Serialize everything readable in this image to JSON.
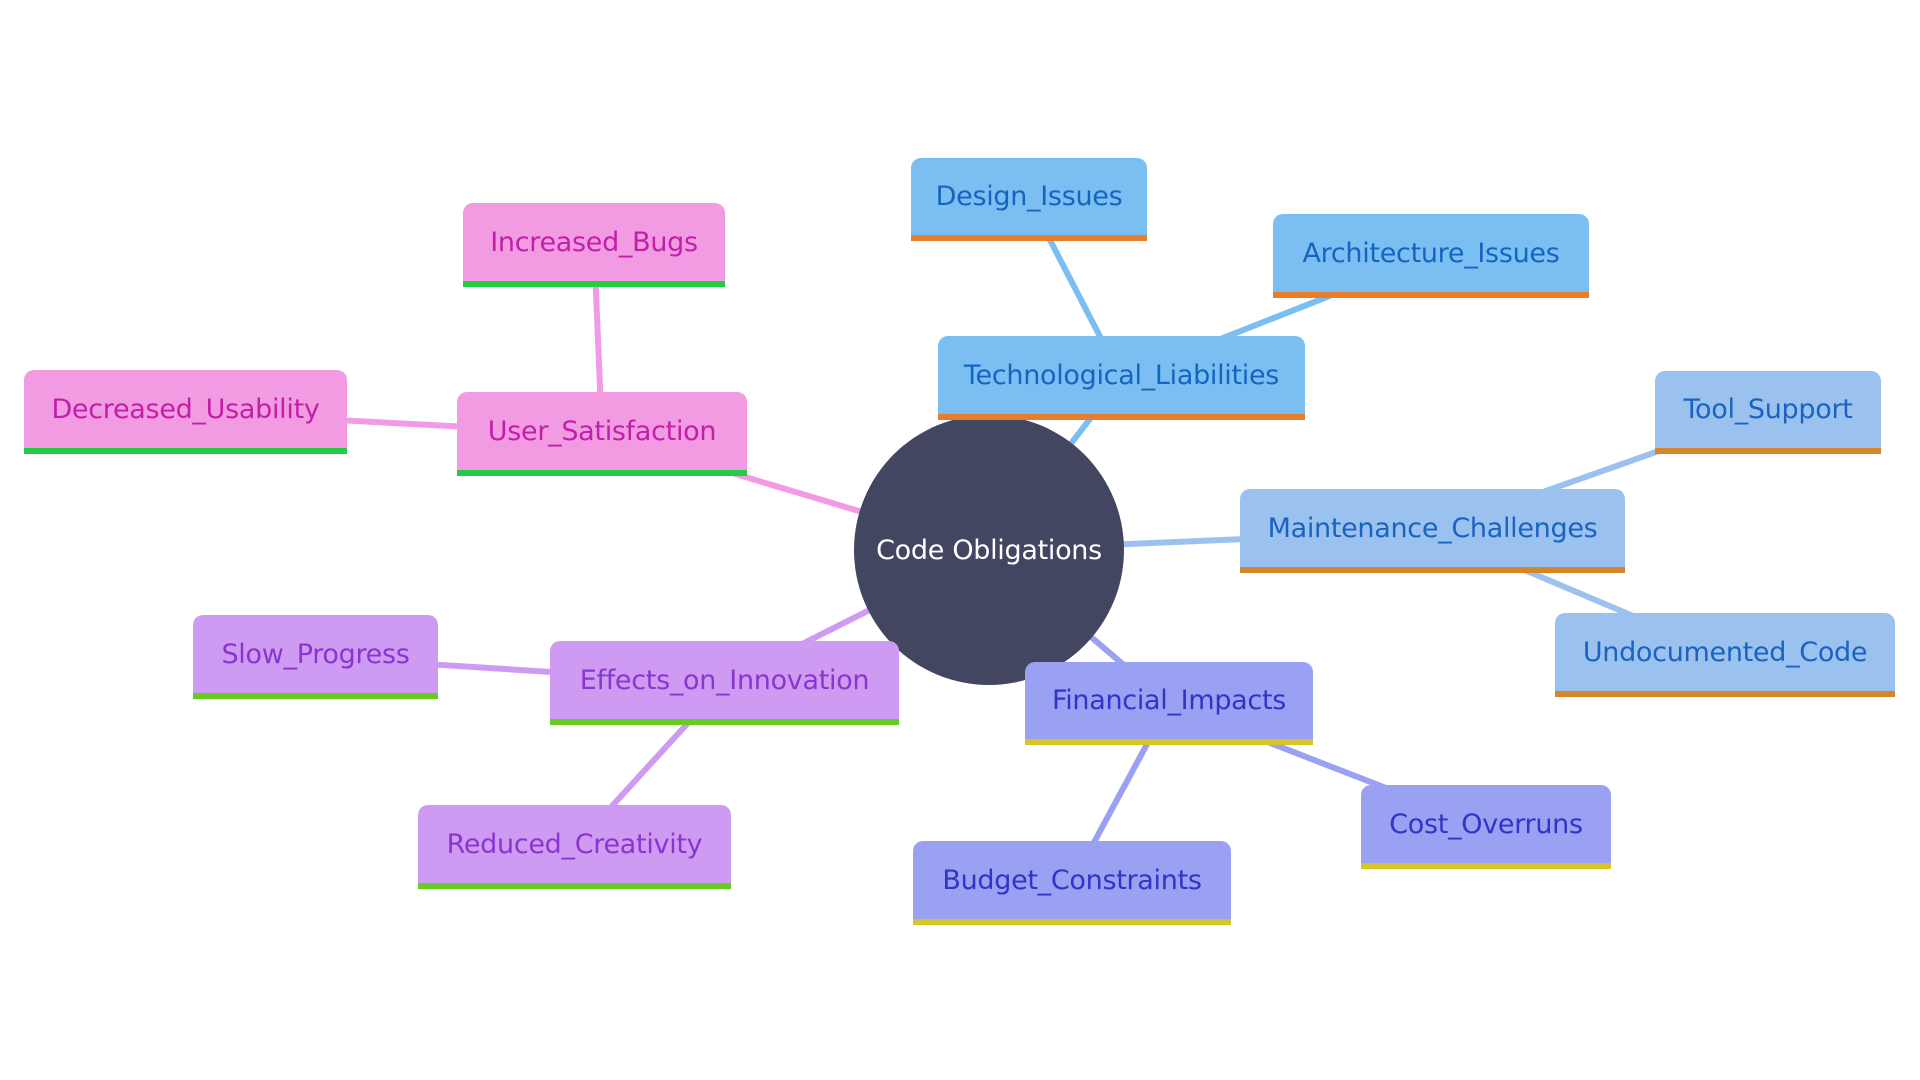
{
  "diagram": {
    "type": "mindmap",
    "root": {
      "label": "Code Obligations",
      "color": "#424660",
      "text_color": "#ffffff"
    },
    "branches": [
      {
        "id": "tech",
        "label": "Technological_Liabilities",
        "fill": "#7bbff2",
        "text_color": "#1565c0",
        "bar_color": "#e87d2c",
        "edge_color": "#7bbff2",
        "children": [
          {
            "id": "design",
            "label": "Design_Issues"
          },
          {
            "id": "arch",
            "label": "Architecture_Issues"
          }
        ]
      },
      {
        "id": "maint",
        "label": "Maintenance_Challenges",
        "fill": "#9bc2ef",
        "text_color": "#1a63c0",
        "bar_color": "#d6852a",
        "edge_color": "#9bc2ef",
        "children": [
          {
            "id": "tool",
            "label": "Tool_Support"
          },
          {
            "id": "undoc",
            "label": "Undocumented_Code"
          }
        ]
      },
      {
        "id": "fin",
        "label": "Financial_Impacts",
        "fill": "#9aa0f2",
        "text_color": "#2f35c4",
        "bar_color": "#d4c62a",
        "edge_color": "#9aa0f2",
        "children": [
          {
            "id": "cost",
            "label": "Cost_Overruns"
          },
          {
            "id": "budget",
            "label": "Budget_Constraints"
          }
        ]
      },
      {
        "id": "innov",
        "label": "Effects_on_Innovation",
        "fill": "#cf9bf2",
        "text_color": "#8a35cf",
        "bar_color": "#66cc22",
        "edge_color": "#cf9bf2",
        "children": [
          {
            "id": "slow",
            "label": "Slow_Progress"
          },
          {
            "id": "reduced",
            "label": "Reduced_Creativity"
          }
        ]
      },
      {
        "id": "user",
        "label": "User_Satisfaction",
        "fill": "#f29be3",
        "text_color": "#c21fa8",
        "bar_color": "#22cc44",
        "edge_color": "#f29be3",
        "children": [
          {
            "id": "bugs",
            "label": "Increased_Bugs"
          },
          {
            "id": "usab",
            "label": "Decreased_Usability"
          }
        ]
      }
    ]
  }
}
